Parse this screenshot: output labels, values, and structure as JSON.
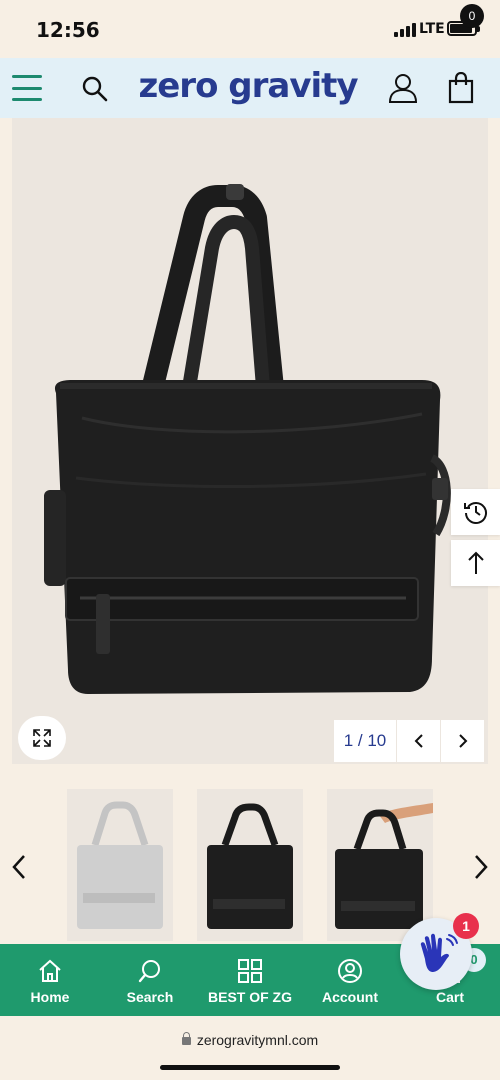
{
  "status_bar": {
    "time": "12:56",
    "network": "LTE"
  },
  "header": {
    "brand": "zero gravity",
    "cart_count": "0",
    "icons": {
      "menu": "hamburger-menu-icon",
      "search": "search-icon",
      "account": "user-icon",
      "cart": "shopping-bag-icon"
    }
  },
  "gallery": {
    "current": 1,
    "total": 10,
    "counter_text": "1 / 10",
    "thumbnails": [
      {
        "name": "thumbnail-1",
        "variant": "light-gray-tote"
      },
      {
        "name": "thumbnail-2",
        "variant": "black-tote-front"
      },
      {
        "name": "thumbnail-3",
        "variant": "black-tote-held"
      }
    ]
  },
  "bottom_nav": {
    "items": [
      {
        "label": "Home",
        "icon": "home-icon"
      },
      {
        "label": "Search",
        "icon": "search-icon"
      },
      {
        "label": "BEST OF ZG",
        "icon": "grid-icon"
      },
      {
        "label": "Account",
        "icon": "account-circle-icon"
      },
      {
        "label": "Cart",
        "icon": "shopping-bag-icon"
      }
    ],
    "cart_count": "0"
  },
  "chat": {
    "badge": "1",
    "icon": "waving-hand-icon"
  },
  "browser": {
    "url": "zerogravitymnl.com"
  },
  "colors": {
    "brand": "#273b8f",
    "nav_bg": "#1f9a6d",
    "header_bg": "#e2f0f7",
    "page_bg": "#f7efe4",
    "badge": "#e8304c"
  }
}
